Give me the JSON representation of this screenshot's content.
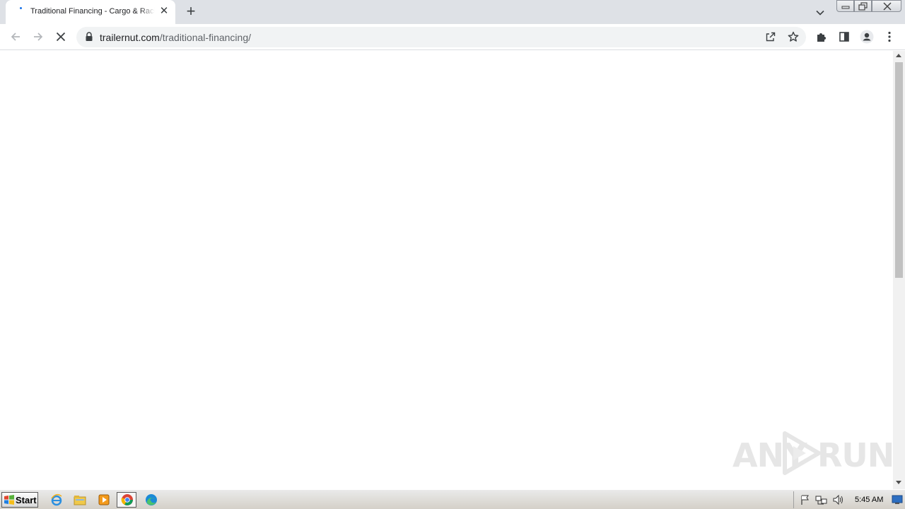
{
  "browser": {
    "tab": {
      "title": "Traditional Financing - Cargo & Racing Trailers",
      "close_glyph": "✕"
    },
    "new_tab_glyph": "+",
    "address_bar": {
      "domain": "trailernut.com",
      "path": "/traditional-financing/"
    },
    "icons": {
      "back": "arrow-left-icon",
      "forward": "arrow-right-icon",
      "stop": "close-icon",
      "lock": "lock-icon",
      "share": "share-icon",
      "bookmark": "star-icon",
      "extensions": "puzzle-icon",
      "side_panel": "side-panel-icon",
      "profile": "profile-icon",
      "menu": "kebab-menu-icon"
    },
    "page_loading": true
  },
  "watermark": {
    "left": "ANY",
    "right": "RUN"
  },
  "taskbar": {
    "start_label": "Start",
    "apps": [
      "internet-explorer-icon",
      "file-explorer-icon",
      "media-player-icon",
      "chrome-icon",
      "edge-icon"
    ],
    "clock": "5:45 AM"
  },
  "colors": {
    "tabstrip": "#dee1e6",
    "omnibox": "#f1f3f4",
    "accent": "#1a73e8"
  }
}
